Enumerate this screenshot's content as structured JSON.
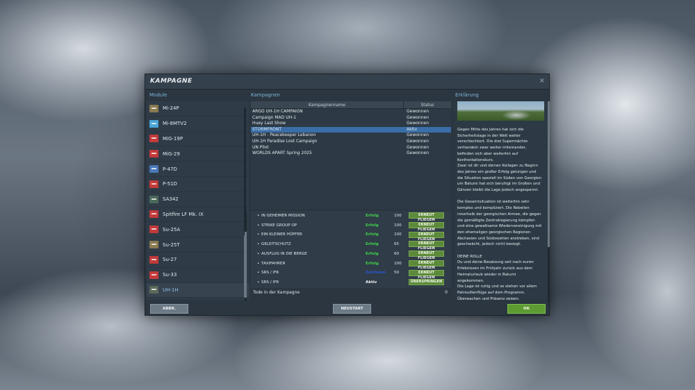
{
  "dialog": {
    "title": "KAMPAGNE",
    "close_glyph": "×",
    "modules_header": "Module",
    "campaigns_header": "Kampagnen",
    "explain_header": "Erklärung"
  },
  "modules": [
    {
      "label": "Mi-24P",
      "icon": "helicopter-icon",
      "color": "#8a7a50"
    },
    {
      "label": "Mi-8MTV2",
      "icon": "helicopter-icon",
      "color": "#4aa3d8"
    },
    {
      "label": "MiG-19P",
      "icon": "jet-icon",
      "color": "#c33a3a"
    },
    {
      "label": "MiG-29",
      "icon": "jet-icon",
      "color": "#c33a3a"
    },
    {
      "label": "P-47D",
      "icon": "plane-icon",
      "color": "#4a78b8"
    },
    {
      "label": "P-51D",
      "icon": "plane-icon",
      "color": "#c33a3a"
    },
    {
      "label": "SA342",
      "icon": "helicopter-icon",
      "color": "#4a6a5a"
    },
    {
      "label": "Spitfire LF Mk. IX",
      "icon": "plane-icon",
      "color": "#c33a3a"
    },
    {
      "label": "Su-25A",
      "icon": "jet-icon",
      "color": "#c33a3a"
    },
    {
      "label": "Su-25T",
      "icon": "jet-icon",
      "color": "#8a7a50"
    },
    {
      "label": "Su-27",
      "icon": "jet-icon",
      "color": "#c33a3a"
    },
    {
      "label": "Su-33",
      "icon": "jet-icon",
      "color": "#c33a3a"
    },
    {
      "label": "UH-1H",
      "icon": "helicopter-icon",
      "color": "#5c6a5a",
      "active": true
    }
  ],
  "campaign_table": {
    "col_name": "Kampagnenname",
    "col_status": "Status",
    "rows": [
      {
        "name": "ARGO UH-1H CAMPAIGN",
        "status": "Gewonnen"
      },
      {
        "name": "Campaign MAD UH-1",
        "status": "Gewonnen"
      },
      {
        "name": "Huey Last Show",
        "status": "Gewonnen"
      },
      {
        "name": "STORMFRONT",
        "status": "Aktiv",
        "selected": true
      },
      {
        "name": "UH-1H - Peacekeeper Lebanon",
        "status": "Gewonnen"
      },
      {
        "name": "UH-1H Paradise Lost Campaign",
        "status": "Gewonnen"
      },
      {
        "name": "UN Pilot",
        "status": "Gewonnen"
      },
      {
        "name": "WORLDS APART Spring 2025",
        "status": "Gewonnen"
      }
    ]
  },
  "missions": [
    {
      "bullet": "•",
      "name": "IN GEHEIMER MISSION",
      "result": "Erfolg",
      "result_color": "#3fd24a",
      "score": "100",
      "button": "ERNEUT FLIEGEN"
    },
    {
      "bullet": "•",
      "name": "STRIKE GROUP OP",
      "result": "Erfolg",
      "result_color": "#3fd24a",
      "score": "100",
      "button": "ERNEUT FLIEGEN"
    },
    {
      "bullet": "•",
      "name": "EIN KLEINER HÜPFER",
      "result": "Erfolg",
      "result_color": "#3fd24a",
      "score": "100",
      "button": "ERNEUT FLIEGEN"
    },
    {
      "bullet": "•",
      "name": "GELEITSCHUTZ",
      "result": "Erfolg",
      "result_color": "#3fd24a",
      "score": "65",
      "button": "ERNEUT FLIEGEN"
    },
    {
      "bullet": "•",
      "name": "AUSFLUG IN DIE BERGE",
      "result": "Erfolg",
      "result_color": "#3fd24a",
      "score": "60",
      "button": "ERNEUT FLIEGEN"
    },
    {
      "bullet": "•",
      "name": "TAXIFAHRER",
      "result": "Erfolg",
      "result_color": "#3fd24a",
      "score": "100",
      "button": "ERNEUT FLIEGEN"
    },
    {
      "bullet": "•",
      "name": "SRS / IFR",
      "result": "Zeichnen",
      "result_color": "#2a5ad8",
      "score": "50",
      "button": "ERNEUT FLIEGEN"
    },
    {
      "bullet": "•",
      "name": "SRS / IFR",
      "result": "Aktiv",
      "result_color": "#f0f4f6",
      "score": "",
      "button": "ÜBERSPRINGEN"
    }
  ],
  "deaths": {
    "label": "Tode in der Kampagne",
    "count": "0"
  },
  "explanation": "Gegen Mitte des Jahres hat sich die\nSicherheitslage in der Welt weiter\nverschlechtert. Die drei Supermächte\nverhandeln zwar weiter miteinander,\nbefinden sich aber weiterhin auf\nKonfrontationskurs.\nZwar ist dir und deinen Kollegen zu Beginn\ndes Jahres ein großer Erfolg gelungen und\ndie Situation speziell im Süden von Georgien\num Batumi hat sich beruhigt im Großen und\nGänzen bleibt die Lage jedoch angespannt.\n\nDie Gesamtsituation ist weiterhin sehr\nkomplex und kompliziert. Die Rebellen\ninnerhalb der georgischen Armee, die gegen\ndie gemäßigte Zentralregierung kämpfen\nund eine gewaltsame Wiedervereinigung mit\nden ehemaligen georgischen Regionen\nAbchasien und Südossetien anstreben, sind\ngeschwächt, jedoch nicht besiegt.\n\nDEINE ROLLE\nDu und deine Besatzung seit nach euren\nErlebnissen im Frühjahr zurück aus dem\nHeimaturlaub wieder in Batumi\nangekommen.\nDie Lage ist ruhig und so stehen vor allem\nPatrouillenflüge auf dem Programm.\nÜberwachen und Präsenz zeigen.",
  "buttons": {
    "abbr": "ABBR.",
    "neustart": "NEUSTART",
    "ok": "OK"
  }
}
